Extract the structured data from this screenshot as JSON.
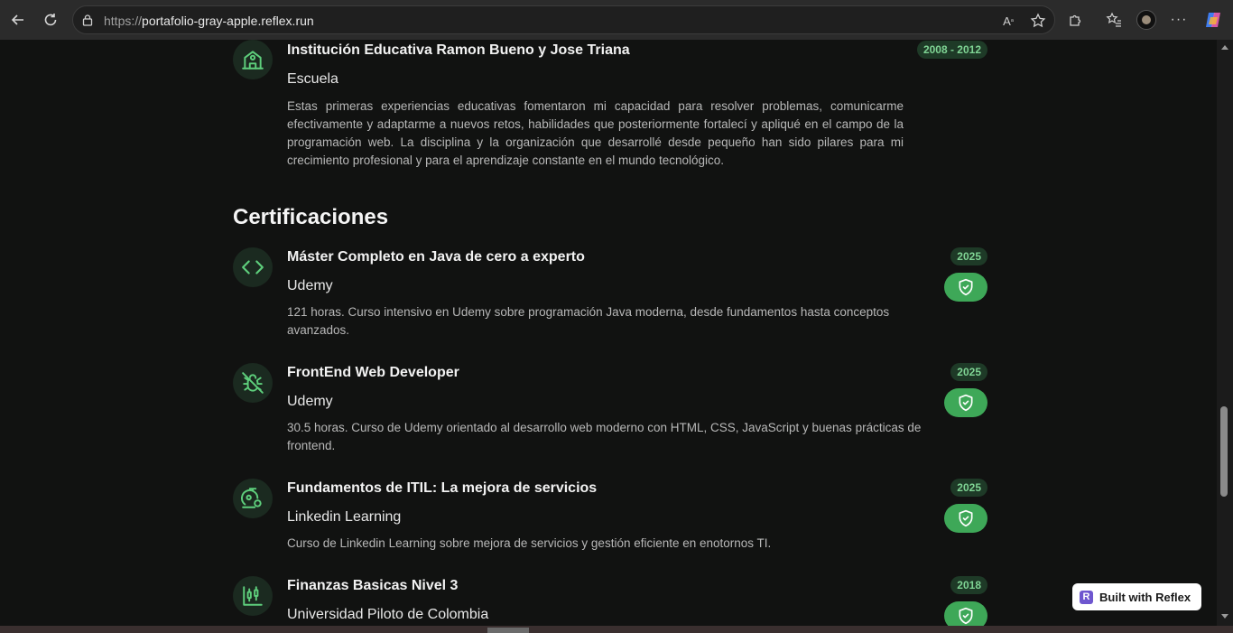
{
  "browser": {
    "url_protocol": "https://",
    "url_host": "portafolio-gray-apple.reflex.run"
  },
  "education": {
    "title": "Institución Educativa Ramon Bueno y Jose Triana",
    "subtitle": "Escuela",
    "year": "2008 - 2012",
    "description": "Estas primeras experiencias educativas fomentaron mi capacidad para resolver problemas, comunicarme efectivamente y adaptarme a nuevos retos, habilidades que posteriormente fortalecí y apliqué en el campo de la programación web. La disciplina y la organización que desarrollé desde pequeño han sido pilares para mi crecimiento profesional y para el aprendizaje constante en el mundo tecnológico.",
    "icon": "school-icon"
  },
  "certifications": {
    "heading": "Certificaciones",
    "items": [
      {
        "title": "Máster Completo en Java de cero a experto",
        "subtitle": "Udemy",
        "year": "2025",
        "description": "121 horas. Curso intensivo en Udemy sobre programación Java moderna, desde fundamentos hasta conceptos avanzados.",
        "icon": "code-icon"
      },
      {
        "title": "FrontEnd Web Developer",
        "subtitle": "Udemy",
        "year": "2025",
        "description": "30.5 horas. Curso de Udemy orientado al desarrollo web moderno con HTML, CSS, JavaScript y buenas prácticas de frontend.",
        "icon": "bug-off-icon"
      },
      {
        "title": "Fundamentos de ITIL: La mejora de servicios",
        "subtitle": "Linkedin Learning",
        "year": "2025",
        "description": "Curso de Linkedin Learning sobre mejora de servicios y gestión eficiente en enotornos TI.",
        "icon": "service-bell-icon"
      },
      {
        "title": "Finanzas Basicas Nivel 3",
        "subtitle": "Universidad Piloto de Colombia",
        "year": "2018",
        "description": "",
        "icon": "candlestick-chart-icon"
      }
    ]
  },
  "badge": {
    "logo_letter": "R",
    "label": "Built with Reflex"
  },
  "colors": {
    "accent": "#3ea858",
    "icon_green": "#5ecf7c",
    "background": "#111211"
  }
}
